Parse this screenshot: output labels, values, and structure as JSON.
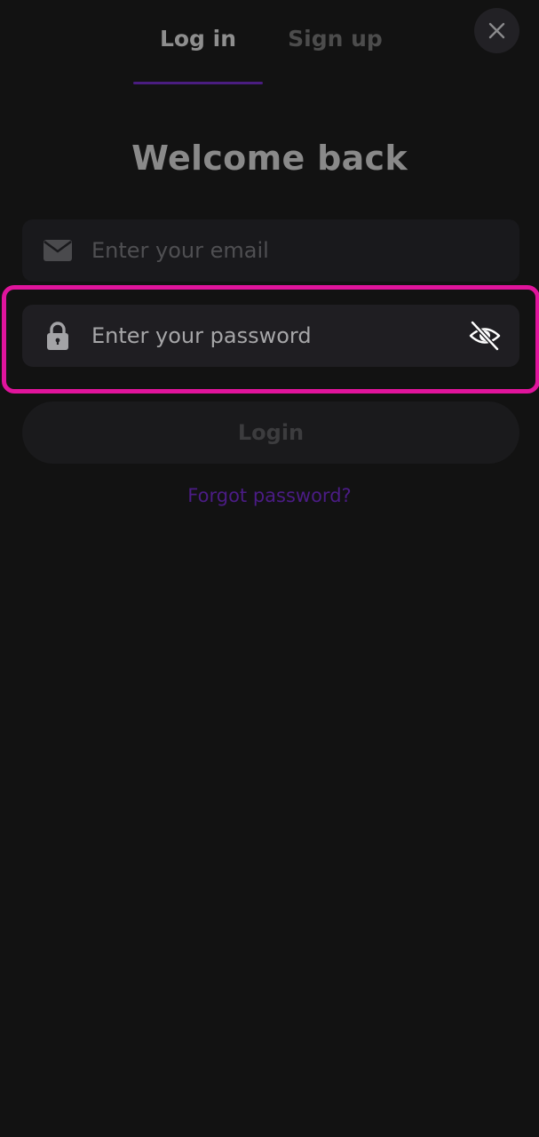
{
  "tabs": {
    "login_label": "Log in",
    "signup_label": "Sign up"
  },
  "title": "Welcome back",
  "email": {
    "placeholder": "Enter your email",
    "icon": "envelope-icon"
  },
  "password": {
    "placeholder": "Enter your password",
    "icon": "lock-icon",
    "visibility_icon": "eye-slash-icon"
  },
  "login_button": "Login",
  "forgot_password": "Forgot password?",
  "close_icon": "close-icon",
  "colors": {
    "background": "#121212",
    "accent": "#4a1d80",
    "highlight": "#e0149c"
  }
}
